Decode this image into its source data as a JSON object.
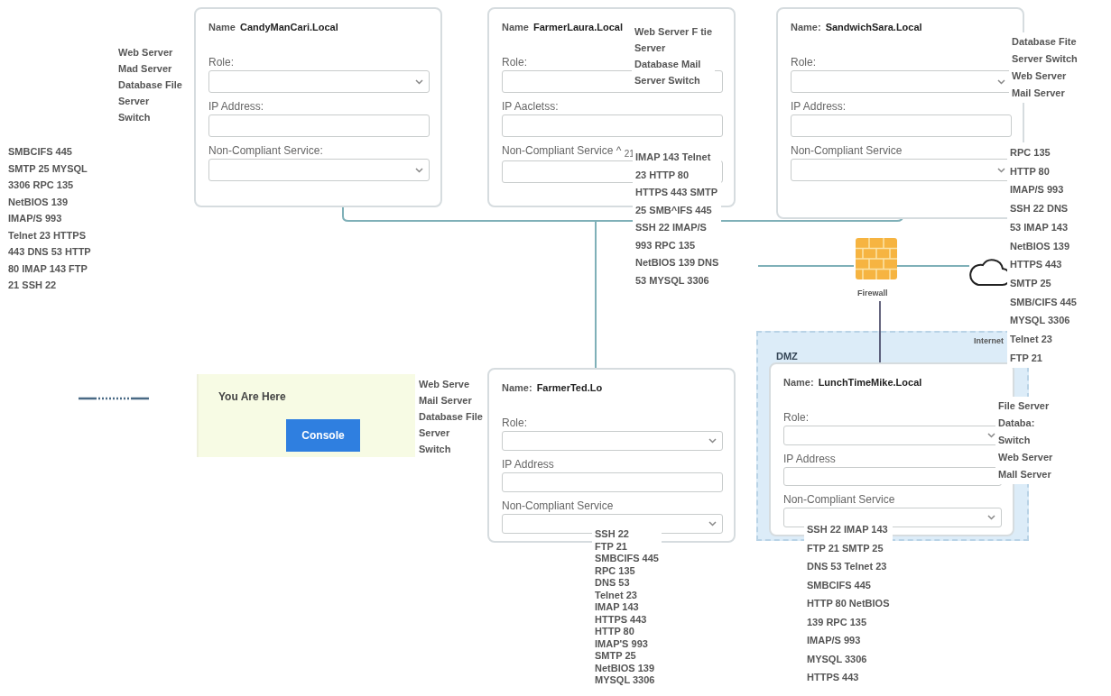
{
  "hosts": [
    {
      "name_label": "Name",
      "name": "CandyManCari.Local",
      "fields": [
        {
          "kind": "select",
          "label": "Role:"
        },
        {
          "kind": "input",
          "label": "IP Address:"
        },
        {
          "kind": "select",
          "label": "Non-Compliant Service:"
        }
      ]
    },
    {
      "name_label": "Name",
      "name": "FarmerLaura.Local",
      "fields": [
        {
          "kind": "select",
          "label": "Role:",
          "caret": false
        },
        {
          "kind": "input",
          "label": "IP Aacletss:"
        },
        {
          "kind": "select",
          "label": "Non-Compliant Service ^ $_{21}$"
        }
      ]
    },
    {
      "name_label": "Name:",
      "name": "SandwichSara.Local",
      "fields": [
        {
          "kind": "select",
          "label": "Role:"
        },
        {
          "kind": "input",
          "label": "IP Address:"
        },
        {
          "kind": "select",
          "label": "Non-Compliant Service"
        }
      ]
    },
    {
      "name_label": "Name:",
      "name": "FarmerTed.Lo",
      "fields": [
        {
          "kind": "select",
          "label": "Role:"
        },
        {
          "kind": "input",
          "label": "IP Address"
        },
        {
          "kind": "select",
          "label": "Non-Compliant Service"
        }
      ]
    },
    {
      "name_label": "Name:",
      "name": "LunchTimeMike.Local",
      "fields": [
        {
          "kind": "select",
          "label": "Role:"
        },
        {
          "kind": "input",
          "label": "IP Address"
        },
        {
          "kind": "select",
          "label": "Non-Compliant Service"
        }
      ]
    }
  ],
  "role_lists": [
    {
      "items": [
        "Web Server",
        "Mad Server",
        "Database File",
        "Server",
        "Switch"
      ]
    },
    {
      "items": [
        "Web Server F tie",
        "Server",
        "Database Mail",
        "Server Switch"
      ]
    },
    {
      "items": [
        "Database Fite",
        "Server Switch",
        "Web Server",
        "Mail Server"
      ]
    },
    {
      "items": [
        "Web Serve",
        "Mail Server",
        "Database File",
        "Server",
        "Switch"
      ]
    },
    {
      "items": [
        "File Server",
        "Databa:",
        "Switch",
        "Web Server",
        "Mall Server"
      ]
    }
  ],
  "service_lists": [
    {
      "items": [
        "SMBCIFS 445",
        "SMTP 25 MYSQL",
        "3306 RPC 135",
        "NetBIOS 139",
        "IMAP/S 993",
        "Telnet 23 HTTPS",
        "443 DNS 53 HTTP",
        "80 IMAP 143 FTP",
        "21 SSH 22"
      ]
    },
    {
      "items": [
        "IMAP 143 Telnet",
        "23 HTTP 80",
        "HTTPS 443 SMTP",
        "25 SMB^IFS 445",
        "SSH 22 IMAP/S",
        "993 RPC 135",
        "NetBIOS 139 DNS",
        "53 MYSQL 3306"
      ]
    },
    {
      "items": [
        "RPC 135",
        "HTTP 80",
        "IMAP/S 993",
        "SSH 22 DNS",
        "53 IMAP 143",
        "NetBIOS 139",
        "HTTPS 443",
        "SMTP 25",
        "SMB/CIFS 445",
        "MYSQL 3306",
        "Telnet 23",
        "FTP 21"
      ]
    },
    {
      "items": [
        "SSH 22",
        "FTP 21",
        "SMBCIFS 445",
        "RPC 135",
        "DNS 53",
        "Telnet 23",
        "IMAP 143",
        "HTTPS 443",
        "HTTP 80",
        "IMAP'S 993",
        "SMTP 25",
        "NetBIOS 139",
        "MYSQL 3306"
      ]
    },
    {
      "items": [
        "SSH 22 IMAP 143",
        "FTP 21 SMTP 25",
        "DNS 53 Telnet 23",
        "SMBCIFS 445",
        "HTTP 80 NetBIOS",
        "139 RPC 135",
        "IMAP/S 993",
        "MYSQL 3306",
        "HTTPS 443"
      ]
    }
  ],
  "panel": {
    "title": "You Are Here",
    "button": "Console"
  },
  "firewall": {
    "label": "Firewall"
  },
  "internet": {
    "label": "Internet"
  },
  "dmz": {
    "label": "DMZ"
  }
}
